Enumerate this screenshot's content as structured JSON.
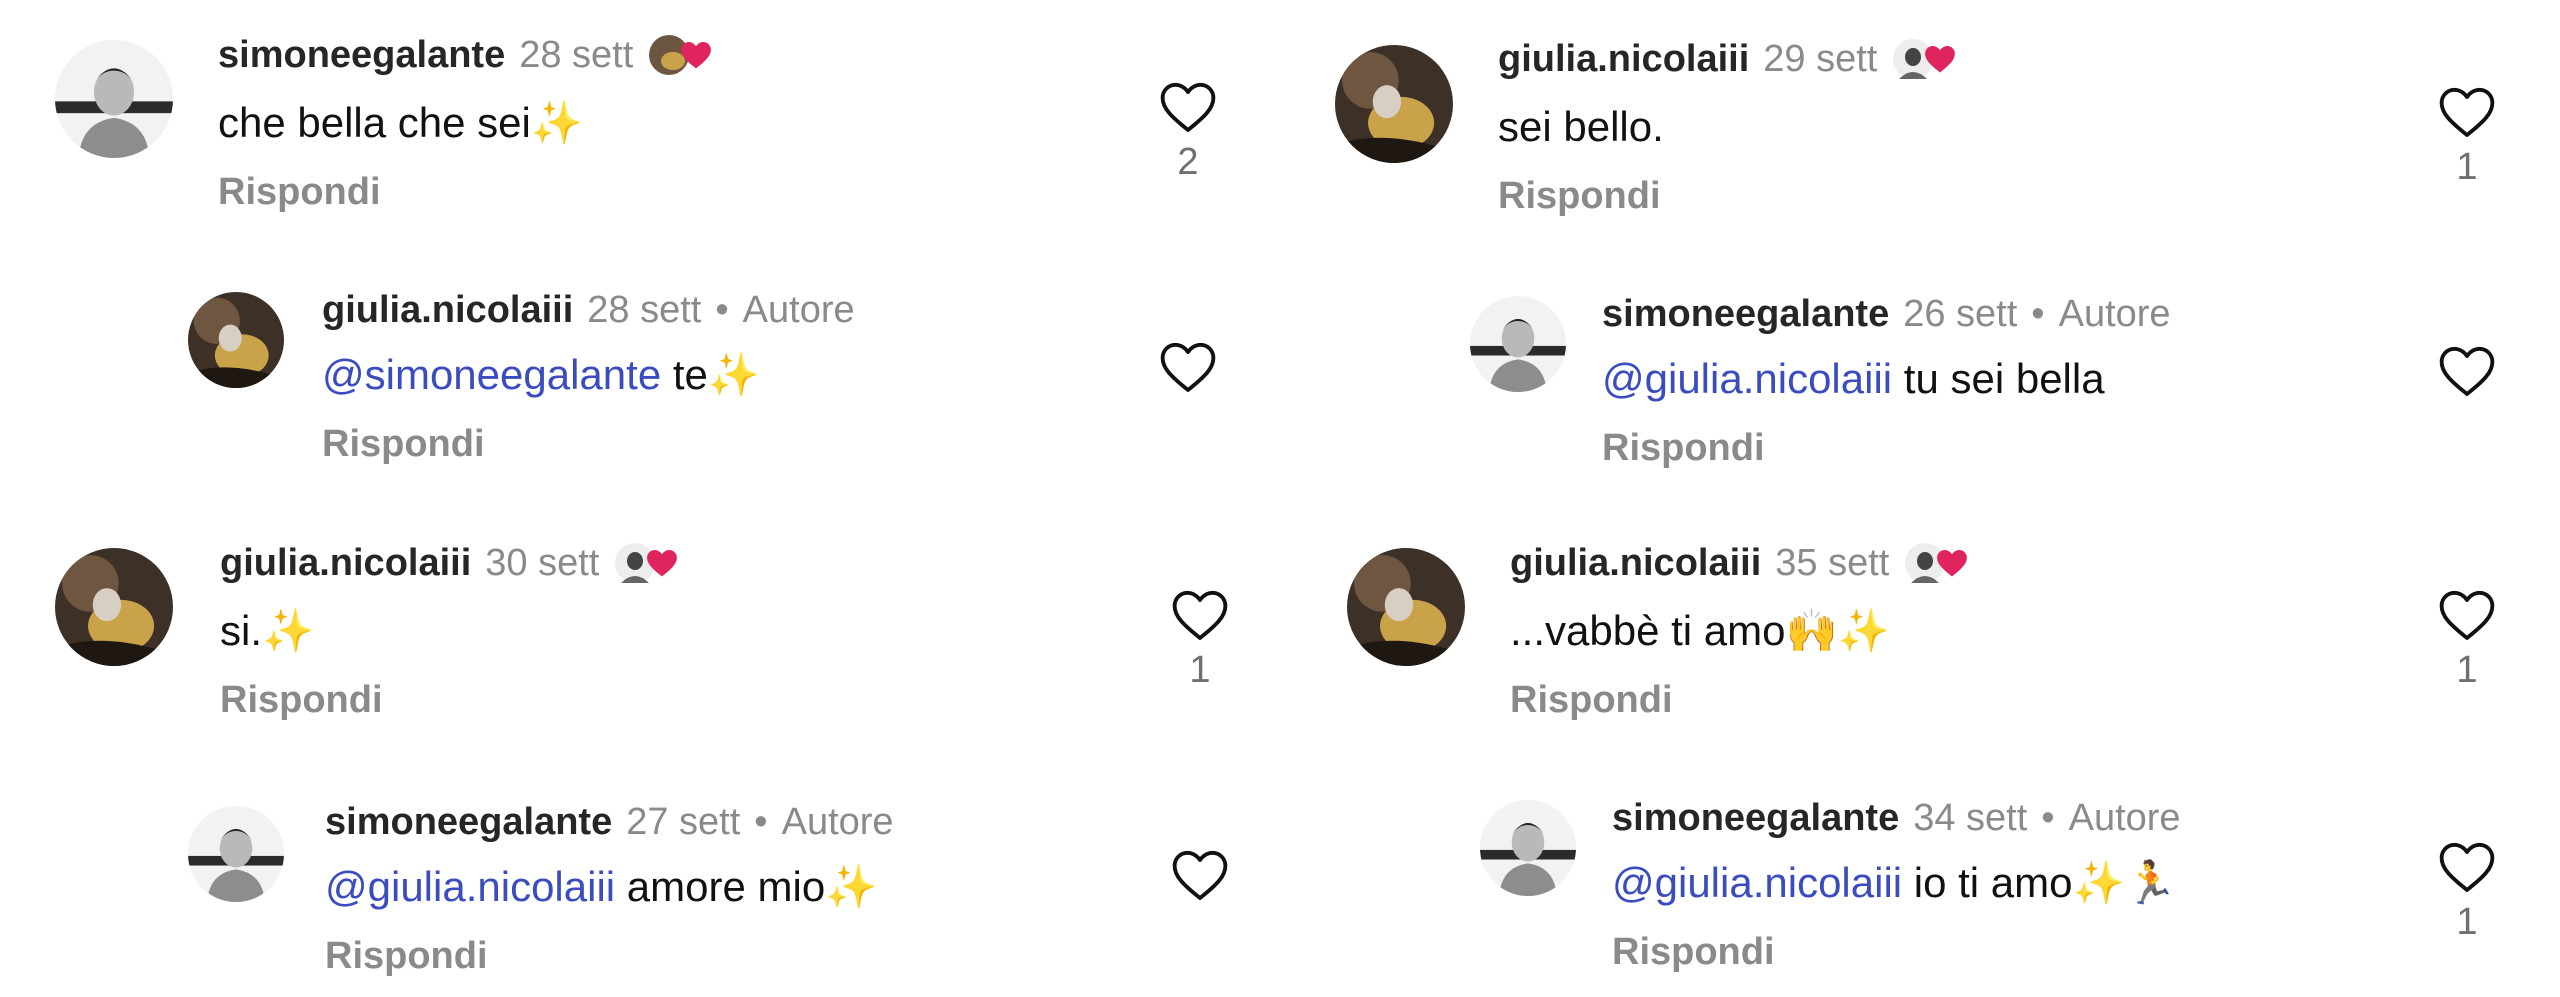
{
  "common": {
    "reply_label": "Rispondi",
    "author_badge": "Autore",
    "separator": "•"
  },
  "left_column": [
    {
      "username": "simoneegalante",
      "time": "28 sett",
      "text": "che bella che sei✨",
      "likes": "2",
      "reaction": "liked-by-avatar-heart-icon"
    },
    {
      "username": "giulia.nicolaiii",
      "time": "28 sett",
      "mention": "@simoneegalante",
      "text": " te✨",
      "likes": "",
      "author": true
    },
    {
      "username": "giulia.nicolaiii",
      "time": "30 sett",
      "text": "si.✨",
      "likes": "1",
      "reaction": "liked-by-avatar-heart-icon"
    },
    {
      "username": "simoneegalante",
      "time": "27 sett",
      "mention": "@giulia.nicolaiii",
      "text": " amore mio✨",
      "likes": "",
      "author": true
    }
  ],
  "right_column": [
    {
      "username": "giulia.nicolaiii",
      "time": "29 sett",
      "text": "sei bello.",
      "likes": "1",
      "reaction": "liked-by-avatar-heart-icon"
    },
    {
      "username": "simoneegalante",
      "time": "26 sett",
      "mention": "@giulia.nicolaiii",
      "text": " tu sei bella",
      "likes": "",
      "author": true
    },
    {
      "username": "giulia.nicolaiii",
      "time": "35 sett",
      "text": "...vabbè ti amo🙌✨",
      "likes": "1",
      "reaction": "liked-by-avatar-heart-icon"
    },
    {
      "username": "simoneegalante",
      "time": "34 sett",
      "mention": "@giulia.nicolaiii",
      "text": " io ti amo✨🏃",
      "likes": "1",
      "author": true
    }
  ],
  "colors": {
    "mention": "#3b4cc0",
    "muted": "#8a8a8a",
    "heart": "#e0245e"
  }
}
